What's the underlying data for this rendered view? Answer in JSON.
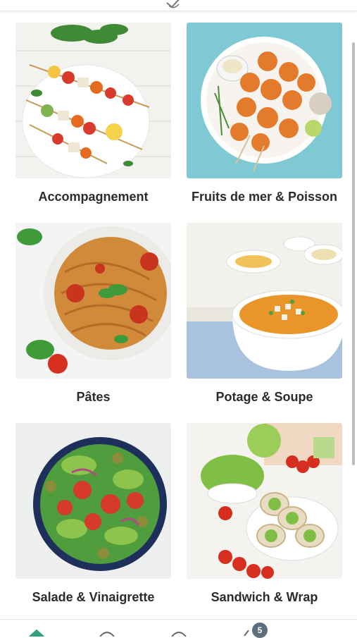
{
  "categories": [
    {
      "label": "Accompagnement"
    },
    {
      "label": "Fruits de mer & Poisson"
    },
    {
      "label": "Pâtes"
    },
    {
      "label": "Potage & Soupe"
    },
    {
      "label": "Salade & Vinaigrette"
    },
    {
      "label": "Sandwich & Wrap"
    }
  ],
  "bottom_nav": {
    "items": [
      {
        "icon": "home-icon"
      },
      {
        "icon": "search-icon"
      },
      {
        "icon": "profile-icon"
      },
      {
        "icon": "cart-icon"
      }
    ],
    "badge_count": "5"
  },
  "colors": {
    "accent": "#2fa37a",
    "badge": "#5d6f7b",
    "text": "#2b2b2b"
  }
}
